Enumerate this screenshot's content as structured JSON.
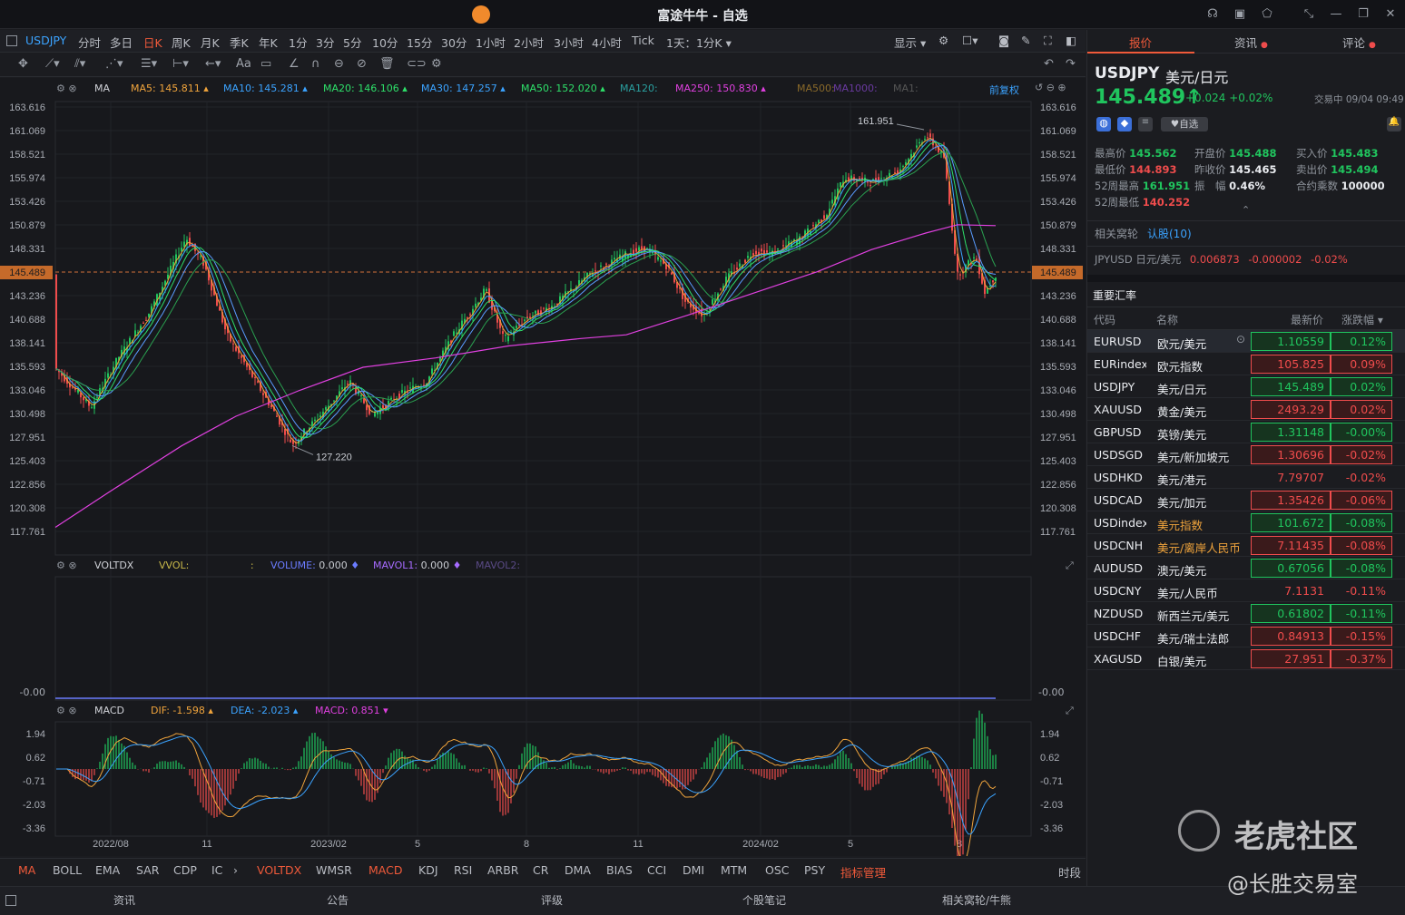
{
  "window": {
    "title": "富途牛牛 - 自选"
  },
  "timeframes": {
    "symbol": "USDJPY",
    "items": [
      "分时",
      "多日",
      "日K",
      "周K",
      "月K",
      "季K",
      "年K",
      "1分",
      "3分",
      "5分",
      "10分",
      "15分",
      "30分",
      "1小时",
      "2小时",
      "3小时",
      "4小时",
      "Tick",
      "1天：1分K"
    ],
    "active": "日K",
    "display": "显示"
  },
  "main_indicator": {
    "name": "MA",
    "items": [
      {
        "label": "MA5:",
        "value": "145.811",
        "color": "#f0a43c"
      },
      {
        "label": "MA10:",
        "value": "145.281",
        "color": "#3ba3ff"
      },
      {
        "label": "MA20:",
        "value": "146.106",
        "color": "#2ee06a"
      },
      {
        "label": "MA30:",
        "value": "147.257",
        "color": "#3ba3ff"
      },
      {
        "label": "MA50:",
        "value": "152.020",
        "color": "#2ee06a"
      },
      {
        "label": "MA120:",
        "value": "",
        "color": "#2aa0a0"
      },
      {
        "label": "MA250:",
        "value": "150.830",
        "color": "#e040e0"
      },
      {
        "label": "MA500:",
        "value": "",
        "color": "#8a6a2a"
      },
      {
        "label": "MA1000:",
        "value": "",
        "color": "#6a3aa0"
      },
      {
        "label": "MA1:",
        "value": "",
        "color": "#555"
      }
    ],
    "fq": "前复权"
  },
  "price_axis": [
    "163.616",
    "161.069",
    "158.521",
    "155.974",
    "153.426",
    "150.879",
    "148.331",
    "145.489",
    "143.236",
    "140.688",
    "138.141",
    "135.593",
    "133.046",
    "130.498",
    "127.951",
    "125.403",
    "122.856",
    "120.308",
    "117.761"
  ],
  "current_price_tag": "145.489",
  "annotations": {
    "high": "161.951",
    "low": "127.220"
  },
  "vol_indicator": {
    "name": "VOLTDX",
    "vvol": "VVOL:",
    "vvol_val": ":",
    "volume": "VOLUME:",
    "volume_val": "0.000",
    "mavol1": "MAVOL1:",
    "mavol1_val": "0.000",
    "mavol2": "MAVOL2:",
    "axis": "-0.00"
  },
  "macd_indicator": {
    "name": "MACD",
    "dif": "DIF:",
    "dif_val": "-1.598",
    "dea": "DEA:",
    "dea_val": "-2.023",
    "macd": "MACD:",
    "macd_val": "0.851",
    "axis": [
      "1.94",
      "0.62",
      "-0.71",
      "-2.03",
      "-3.36"
    ]
  },
  "date_axis": [
    "2022/08",
    "11",
    "2023/02",
    "5",
    "8",
    "11",
    "2024/02",
    "5",
    "8"
  ],
  "indicator_tabs": [
    "MA",
    "BOLL",
    "EMA",
    "SAR",
    "CDP",
    "IC",
    "VOLTDX",
    "WMSR",
    "MACD",
    "KDJ",
    "RSI",
    "ARBR",
    "CR",
    "DMA",
    "BIAS",
    "CCI",
    "DMI",
    "MTM",
    "OSC",
    "PSY",
    "指标管理"
  ],
  "period_label": "时段",
  "status_bar": [
    "资讯",
    "公告",
    "评级",
    "个股笔记",
    "相关窝轮/牛熊"
  ],
  "right_panel": {
    "tabs": [
      "报价",
      "资讯",
      "评论"
    ],
    "symbol": "USDJPY",
    "name": "美元/日元",
    "price": "145.489",
    "change": "+0.024",
    "change_pct": "+0.02%",
    "trade_time": "交易中 09/04 09:49",
    "watch_label": "自选",
    "stats": [
      {
        "k": "最高价",
        "v": "145.562",
        "c": "green"
      },
      {
        "k": "开盘价",
        "v": "145.488",
        "c": "green"
      },
      {
        "k": "买入价",
        "v": "145.483",
        "c": "green"
      },
      {
        "k": "最低价",
        "v": "144.893",
        "c": "red"
      },
      {
        "k": "昨收价",
        "v": "145.465",
        "c": "white"
      },
      {
        "k": "卖出价",
        "v": "145.494",
        "c": "green"
      },
      {
        "k": "52周最高",
        "v": "161.951",
        "c": "green"
      },
      {
        "k": "振　幅",
        "v": "0.46%",
        "c": "white"
      },
      {
        "k": "合约乘数",
        "v": "100000",
        "c": "white"
      },
      {
        "k": "52周最低",
        "v": "140.252",
        "c": "red"
      }
    ],
    "warrant_label": "相关窝轮",
    "warrant_value": "认股(10)",
    "jpy": {
      "sym": "JPYUSD",
      "name": "日元/美元",
      "price": "0.006873",
      "chg": "-0.000002",
      "pct": "-0.02%"
    },
    "section_title": "重要汇率",
    "table_headers": [
      "代码",
      "名称",
      "最新价",
      "涨跌幅"
    ],
    "rows": [
      {
        "code": "EURUSD",
        "name": "欧元/美元",
        "price": "1.10559",
        "pct": "0.12%",
        "dir": "up"
      },
      {
        "code": "EURindex",
        "name": "欧元指数",
        "price": "105.825",
        "pct": "0.09%",
        "dir": "down"
      },
      {
        "code": "USDJPY",
        "name": "美元/日元",
        "price": "145.489",
        "pct": "0.02%",
        "dir": "up"
      },
      {
        "code": "XAUUSD",
        "name": "黄金/美元",
        "price": "2493.29",
        "pct": "0.02%",
        "dir": "down"
      },
      {
        "code": "GBPUSD",
        "name": "英镑/美元",
        "price": "1.31148",
        "pct": "-0.00%",
        "dir": "up"
      },
      {
        "code": "USDSGD",
        "name": "美元/新加坡元",
        "price": "1.30696",
        "pct": "-0.02%",
        "dir": "down"
      },
      {
        "code": "USDHKD",
        "name": "美元/港元",
        "price": "7.79707",
        "pct": "-0.02%",
        "dir": "none"
      },
      {
        "code": "USDCAD",
        "name": "美元/加元",
        "price": "1.35426",
        "pct": "-0.06%",
        "dir": "down"
      },
      {
        "code": "USDindex",
        "name": "美元指数",
        "price": "101.672",
        "pct": "-0.08%",
        "dir": "up",
        "orange": true
      },
      {
        "code": "USDCNH",
        "name": "美元/离岸人民币",
        "price": "7.11435",
        "pct": "-0.08%",
        "dir": "down",
        "orange": true
      },
      {
        "code": "AUDUSD",
        "name": "澳元/美元",
        "price": "0.67056",
        "pct": "-0.08%",
        "dir": "up"
      },
      {
        "code": "USDCNY",
        "name": "美元/人民币",
        "price": "7.1131",
        "pct": "-0.11%",
        "dir": "none"
      },
      {
        "code": "NZDUSD",
        "name": "新西兰元/美元",
        "price": "0.61802",
        "pct": "-0.11%",
        "dir": "up"
      },
      {
        "code": "USDCHF",
        "name": "美元/瑞士法郎",
        "price": "0.84913",
        "pct": "-0.15%",
        "dir": "down"
      },
      {
        "code": "XAGUSD",
        "name": "白银/美元",
        "price": "27.951",
        "pct": "-0.37%",
        "dir": "down"
      }
    ]
  },
  "watermark": {
    "line1": "老虎社区",
    "line2": "@长胜交易室"
  },
  "colors": {
    "up": "#20c55e",
    "down": "#ef4c4c",
    "accent": "#f05a3a",
    "ma250": "#e040e0"
  }
}
